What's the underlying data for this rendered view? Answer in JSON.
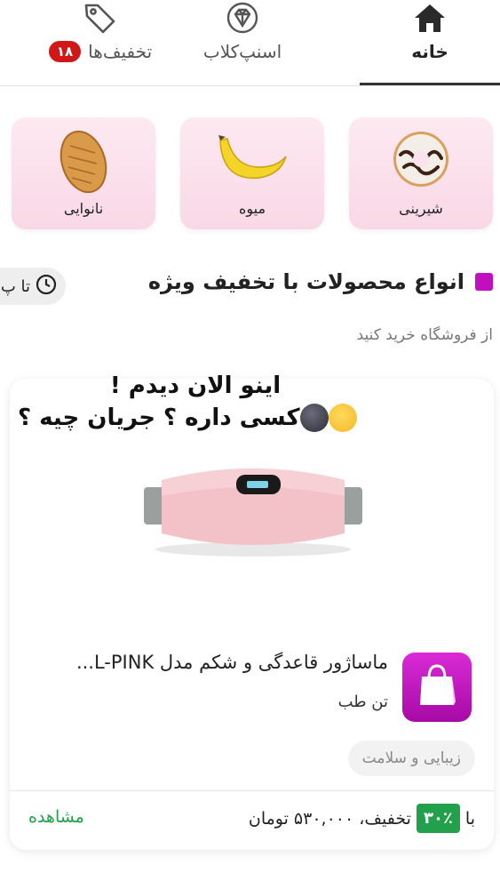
{
  "tabs": [
    {
      "label": "خانه",
      "icon": "home-icon"
    },
    {
      "label": "اسنپ‌کلاب",
      "icon": "diamond-icon"
    },
    {
      "label": "تخفیف‌ها",
      "icon": "tag-icon",
      "badge": "۱۸"
    }
  ],
  "categories": [
    {
      "label": "شیرینی",
      "icon": "donut-icon"
    },
    {
      "label": "میوه",
      "icon": "banana-icon"
    },
    {
      "label": "نانوایی",
      "icon": "bread-icon"
    }
  ],
  "section": {
    "title": "انواع محصولات با تخفیف ویژه",
    "subtitle": "از فروشگاه خرید کنید",
    "timer_text": "تا پ"
  },
  "overlay": {
    "line1": "اینو الان دیدم !",
    "line2": "کسی داره ؟ جریان چیه ؟"
  },
  "product": {
    "name": "ماساژور قاعدگی و شکم مدل L-PINK...",
    "shop": "تن طب",
    "category_tag": "زیبایی و سلامت",
    "price_prefix": "با",
    "discount": "۳۰٪",
    "price_text": "تخفیف، ۵۳۰,۰۰۰ تومان",
    "view_label": "مشاهده"
  },
  "colors": {
    "accent": "#c10fbf",
    "green": "#22a04b",
    "badge": "#d01818",
    "category_bg": "#fde9f1"
  }
}
